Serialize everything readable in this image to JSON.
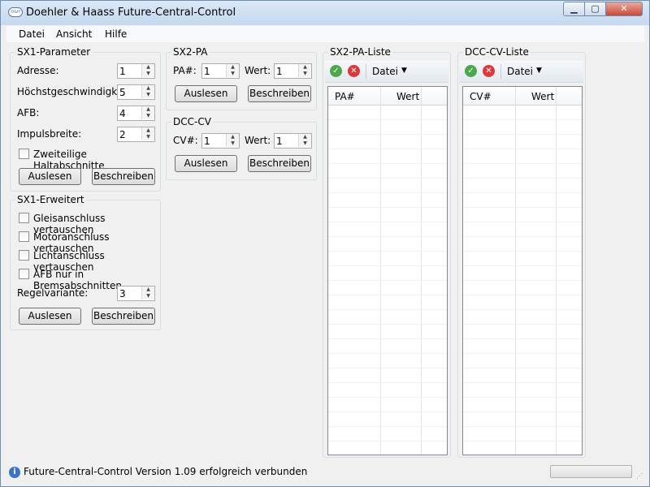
{
  "window": {
    "title": "Doehler & Haass Future-Central-Control",
    "app_icon_text": "D&H"
  },
  "menu": {
    "items": [
      "Datei",
      "Ansicht",
      "Hilfe"
    ]
  },
  "sx1_parameter": {
    "title": "SX1-Parameter",
    "fields": [
      {
        "label": "Adresse:",
        "value": "1"
      },
      {
        "label": "Höchstgeschwindigkeit:",
        "value": "5"
      },
      {
        "label": "AFB:",
        "value": "4"
      },
      {
        "label": "Impulsbreite:",
        "value": "2"
      }
    ],
    "checkbox_label": "Zweiteilige Haltabschnitte",
    "read_label": "Auslesen",
    "write_label": "Beschreiben"
  },
  "sx1_erweitert": {
    "title": "SX1-Erweitert",
    "checkboxes": [
      "Gleisanschluss vertauschen",
      "Motoranschluss vertauschen",
      "Lichtanschluss vertauschen",
      "AFB nur in Bremsabschnitten"
    ],
    "regel_label": "Regelvariante:",
    "regel_value": "3",
    "read_label": "Auslesen",
    "write_label": "Beschreiben"
  },
  "sx2_pa": {
    "title": "SX2-PA",
    "pa_label": "PA#:",
    "pa_value": "1",
    "wert_label": "Wert:",
    "wert_value": "1",
    "read_label": "Auslesen",
    "write_label": "Beschreiben"
  },
  "dcc_cv": {
    "title": "DCC-CV",
    "cv_label": "CV#:",
    "cv_value": "1",
    "wert_label": "Wert:",
    "wert_value": "1",
    "read_label": "Auslesen",
    "write_label": "Beschreiben"
  },
  "sx2_pa_liste": {
    "title": "SX2-PA-Liste",
    "toolbar_menu": "Datei",
    "columns": [
      "PA#",
      "Wert"
    ]
  },
  "dcc_cv_liste": {
    "title": "DCC-CV-Liste",
    "toolbar_menu": "Datei",
    "columns": [
      "CV#",
      "Wert"
    ]
  },
  "status": {
    "text": "Future-Central-Control Version 1.09 erfolgreich verbunden",
    "progress_fraction": 0
  },
  "icons": {
    "ok": "check-circle-icon",
    "delete": "delete-circle-icon",
    "info": "info-icon",
    "dropdown": "chevron-down-icon"
  },
  "colors": {
    "ok": "#4da84d",
    "delete": "#d93b3b",
    "info": "#3b73c7",
    "close": "#c64b3a"
  }
}
